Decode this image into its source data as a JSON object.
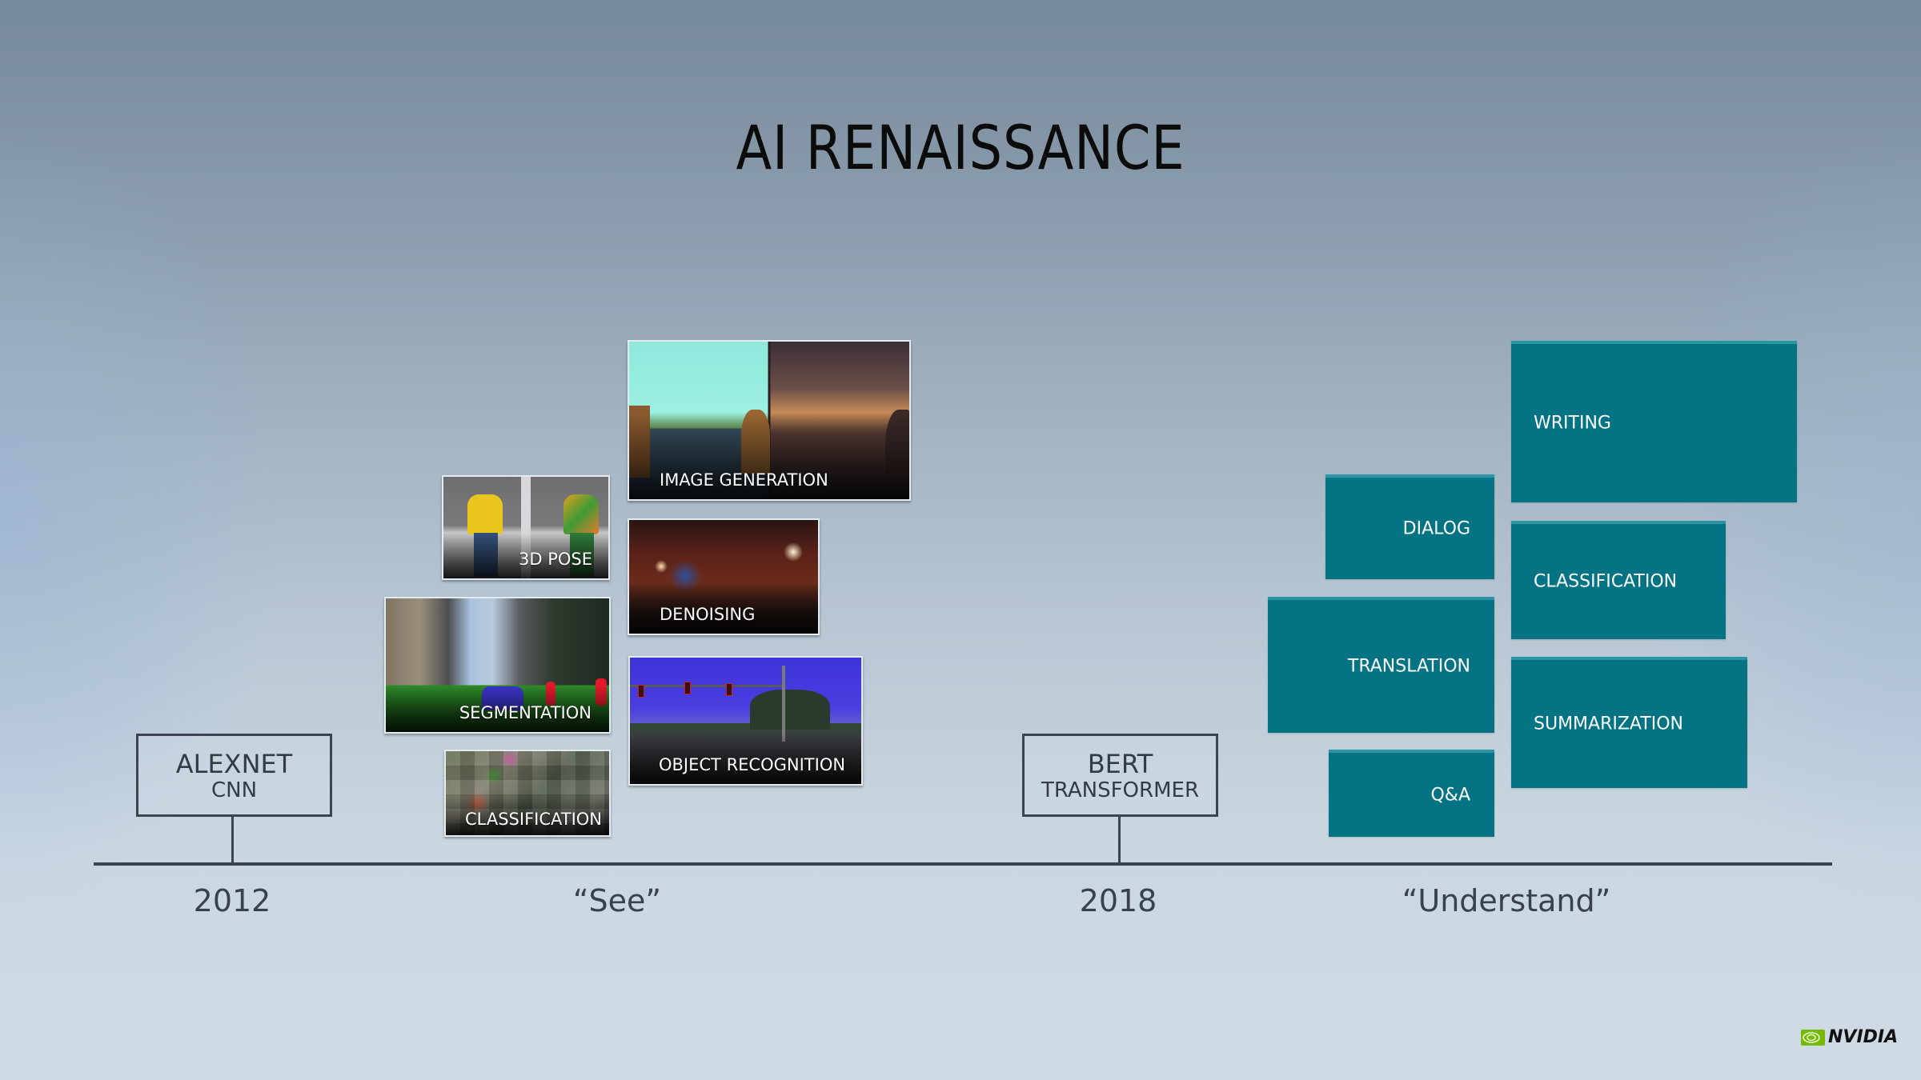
{
  "slide": {
    "title": "AI RENAISSANCE"
  },
  "milestones": [
    {
      "name": "ALEXNET",
      "subtitle": "CNN"
    },
    {
      "name": "BERT",
      "subtitle": "TRANSFORMER"
    }
  ],
  "timeline": {
    "labels": [
      "2012",
      "“See”",
      "2018",
      "“Understand”"
    ]
  },
  "see_tasks": [
    {
      "label": "IMAGE GENERATION",
      "image": "stylized-landscape-to-photo"
    },
    {
      "label": "3D POSE",
      "image": "person-pose-estimation"
    },
    {
      "label": "DENOISING",
      "image": "dim-restaurant-interior"
    },
    {
      "label": "SEGMENTATION",
      "image": "city-street-segmented"
    },
    {
      "label": "OBJECT RECOGNITION",
      "image": "intersection-traffic-lights"
    },
    {
      "label": "CLASSIFICATION",
      "image": "image-grid-mosaic"
    }
  ],
  "understand_tasks": [
    {
      "label": "WRITING"
    },
    {
      "label": "DIALOG"
    },
    {
      "label": "CLASSIFICATION"
    },
    {
      "label": "TRANSLATION"
    },
    {
      "label": "SUMMARIZATION"
    },
    {
      "label": "Q&A"
    }
  ],
  "colors": {
    "tile": "#047383",
    "tile_edge": "#2a95a5",
    "axis": "#3b4450",
    "brand_green": "#76b900"
  },
  "logo": {
    "icon": "nvidia-eye-icon",
    "text": "NVIDIA"
  }
}
